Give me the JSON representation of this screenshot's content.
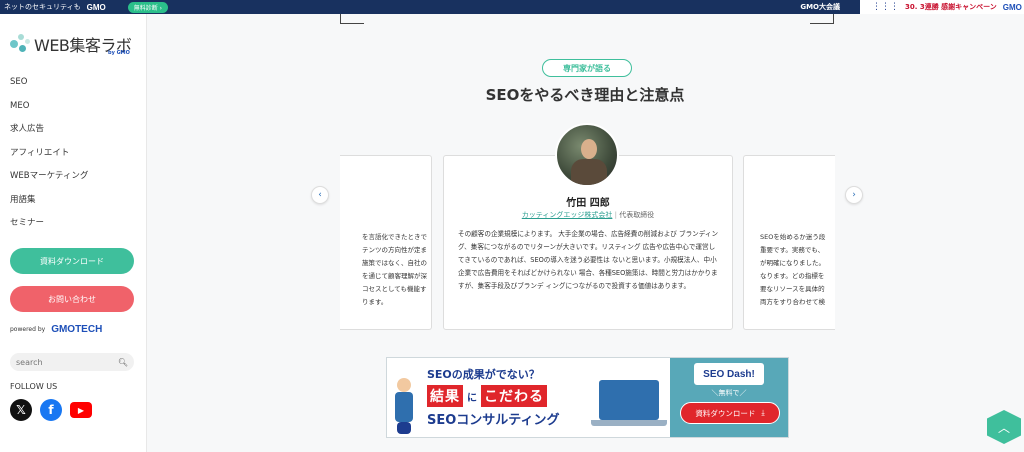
{
  "topbar": {
    "left_text": "ネットのセキュリティも",
    "left_brand": "GMO",
    "badge": "無料診断",
    "right_brand": "GMO大会議",
    "campaign": "30. 3連勝 感謝キャンペーン",
    "campaign_brand": "GMO"
  },
  "sidebar": {
    "logo_text": "WEB集客ラボ",
    "logo_by": "by GMO",
    "nav": [
      "SEO",
      "MEO",
      "求人広告",
      "アフィリエイト",
      "WEBマーケティング",
      "用語集",
      "セミナー"
    ],
    "download_btn": "資料ダウンロード",
    "contact_btn": "お問い合わせ",
    "powered_text": "powered by",
    "powered_brand": "GMOTECH",
    "search_placeholder": "search",
    "follow_label": "FOLLOW US"
  },
  "main": {
    "pill": "専門家が語る",
    "title": "SEOをやるべき理由と注意点",
    "left_card_lines": [
      "を言語化できたときで",
      "テンツの方向性が定ま",
      "施策ではなく、自社の",
      "を通じて顧客理解が深",
      "コセスとしても機能す",
      "ります。"
    ],
    "center_card": {
      "name": "竹田 四郎",
      "company": "カッティングエッジ株式会社",
      "role": "代表取締役",
      "body": "その顧客の企業規模によります。 大手企業の場合、広告経費の削減および ブランディング、集客につながるのでリターンが大きいです。リスティング 広告や広告中心で運営してきているのであれば、SEOの導入を迷う必要性は ないと思います。小規模法人、中小企業で広告費用をそればどかけられない 場合、各種SEO施策は、時間と労力はかかりますが、集客手段及びブランデ ィングにつながるので投資する価値はあります。"
    },
    "right_card_lines": [
      "SEOを始めるか迷う段",
      "重要です。実務でも、",
      "が明確になりました。",
      "なります。どの指標を",
      "要なリソースを具体的",
      "両方をすり合わせて検"
    ]
  },
  "banner": {
    "question": "SEOの成果がでない？",
    "word1": "結果",
    "particle": "に",
    "word2": "こだわる",
    "consult": "SEOコンサルティング",
    "brand": "SEO Dash!",
    "free": "＼無料で／",
    "cta": "資料ダウンロード"
  },
  "colors": {
    "accent_green": "#3fbf9c",
    "accent_red": "#f0626a",
    "navy": "#1d3c8f"
  }
}
